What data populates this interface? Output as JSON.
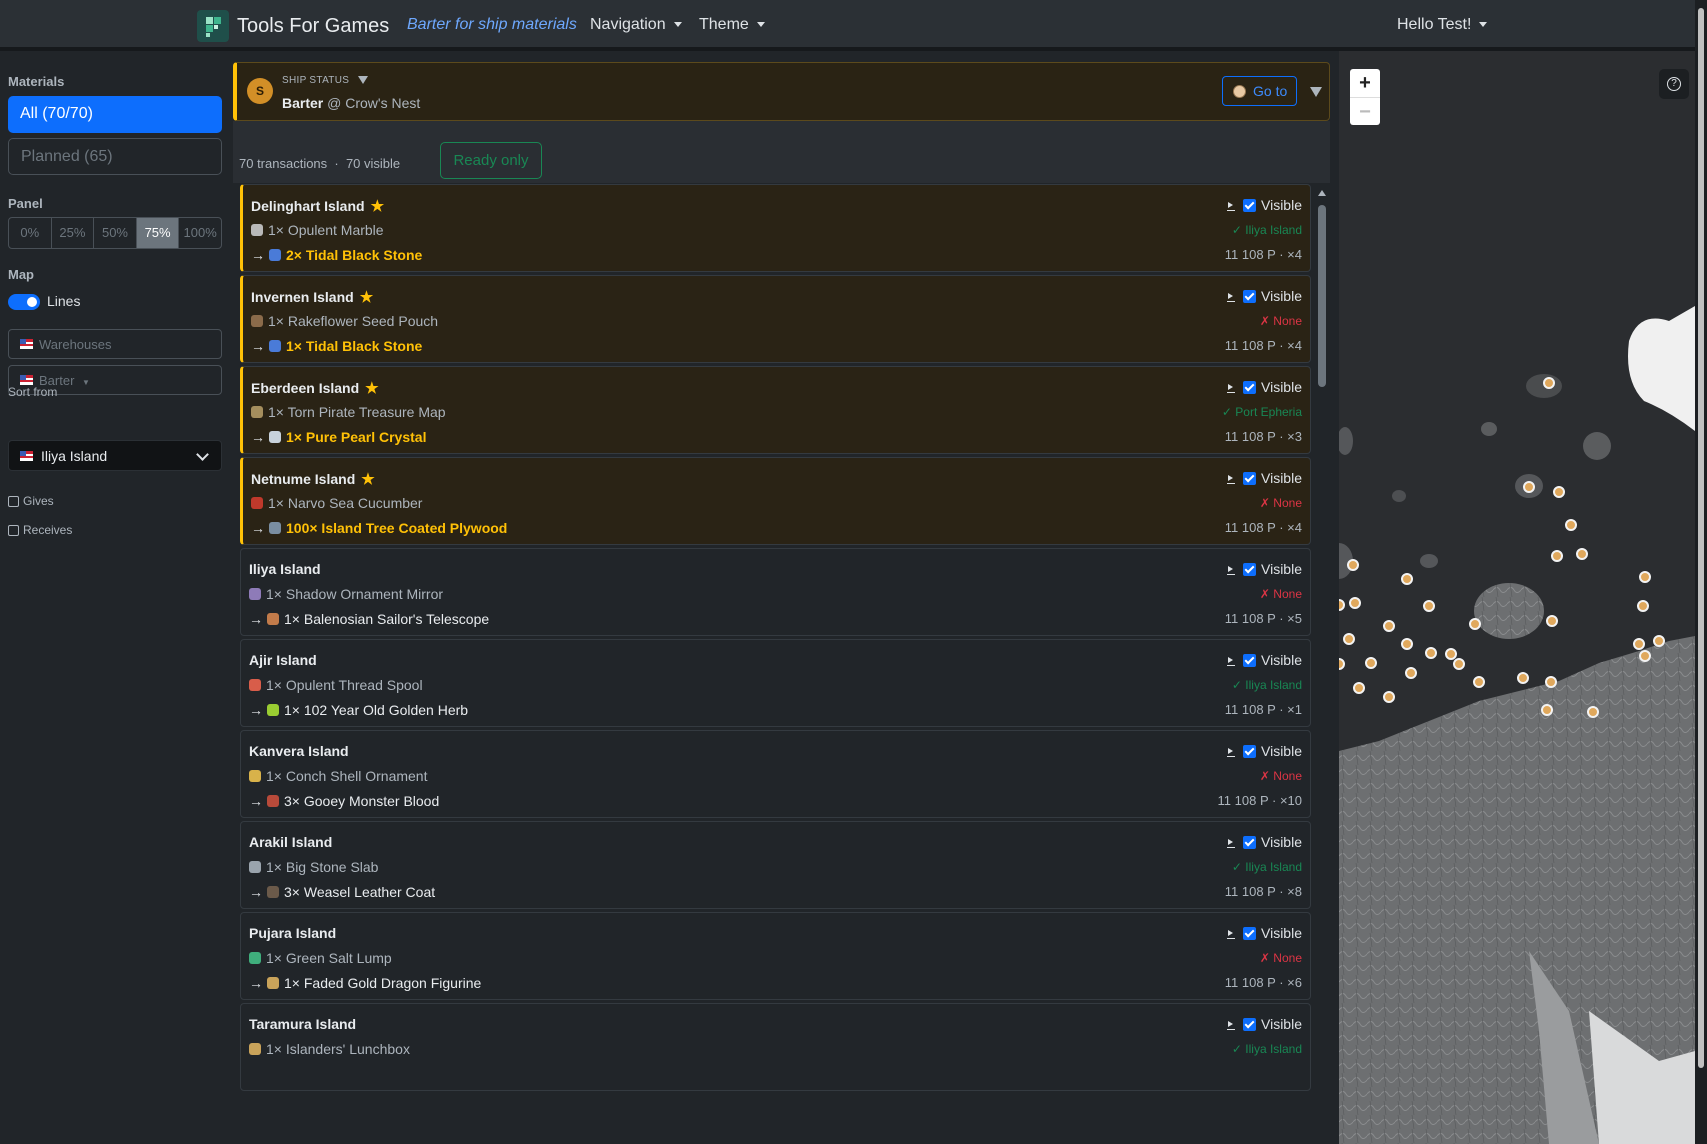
{
  "navbar": {
    "brand": "Tools For Games",
    "active_page": "Barter for ship materials",
    "navigation": "Navigation",
    "theme": "Theme",
    "user": "Hello Test!"
  },
  "sidebar": {
    "materials_label": "Materials",
    "all_button": "All (70/70)",
    "planned_button": "Planned (65)",
    "panel_label": "Panel",
    "panel_options": [
      "0%",
      "25%",
      "50%",
      "75%",
      "100%"
    ],
    "panel_selected": "75%",
    "map_label": "Map",
    "lines_label": "Lines",
    "lines_enabled": true,
    "warehouses_placeholder": "Warehouses",
    "barter_placeholder": "Barter",
    "sort_label": "Sort from",
    "sort_value": "Iliya Island",
    "gives_label": "Gives",
    "receives_label": "Receives"
  },
  "status": {
    "avatar": "S",
    "heading": "SHIP STATUS",
    "activity": "Barter",
    "location": "@ Crow's Nest",
    "goto": "Go to"
  },
  "summary": {
    "text": "70 transactions  ·  70 visible",
    "ready_only": "Ready only"
  },
  "cards": [
    {
      "island": "Delinghart Island",
      "starred": true,
      "give": "1× Opulent Marble",
      "receive": "2× Tidal Black Stone",
      "status": "✓ Iliya Island",
      "status_kind": "ok",
      "price": "11 108 P · ×4",
      "visible": "Visible"
    },
    {
      "island": "Invernen Island",
      "starred": true,
      "give": "1× Rakeflower Seed Pouch",
      "receive": "1× Tidal Black Stone",
      "status": "✗ None",
      "status_kind": "none",
      "price": "11 108 P · ×4",
      "visible": "Visible"
    },
    {
      "island": "Eberdeen Island",
      "starred": true,
      "give": "1× Torn Pirate Treasure Map",
      "receive": "1× Pure Pearl Crystal",
      "status": "✓ Port Epheria",
      "status_kind": "ok",
      "price": "11 108 P · ×3",
      "visible": "Visible"
    },
    {
      "island": "Netnume Island",
      "starred": true,
      "give": "1× Narvo Sea Cucumber",
      "receive": "100× Island Tree Coated Plywood",
      "status": "✗ None",
      "status_kind": "none",
      "price": "11 108 P · ×4",
      "visible": "Visible"
    },
    {
      "island": "Iliya Island",
      "starred": false,
      "give": "1× Shadow Ornament Mirror",
      "receive": "1× Balenosian Sailor's Telescope",
      "status": "✗ None",
      "status_kind": "none",
      "price": "11 108 P · ×5",
      "visible": "Visible"
    },
    {
      "island": "Ajir Island",
      "starred": false,
      "give": "1× Opulent Thread Spool",
      "receive": "1× 102 Year Old Golden Herb",
      "status": "✓ Iliya Island",
      "status_kind": "ok",
      "price": "11 108 P · ×1",
      "visible": "Visible"
    },
    {
      "island": "Kanvera Island",
      "starred": false,
      "give": "1× Conch Shell Ornament",
      "receive": "3× Gooey Monster Blood",
      "status": "✗ None",
      "status_kind": "none",
      "price": "11 108 P · ×10",
      "visible": "Visible"
    },
    {
      "island": "Arakil Island",
      "starred": false,
      "give": "1× Big Stone Slab",
      "receive": "3× Weasel Leather Coat",
      "status": "✓ Iliya Island",
      "status_kind": "ok",
      "price": "11 108 P · ×8",
      "visible": "Visible"
    },
    {
      "island": "Pujara Island",
      "starred": false,
      "give": "1× Green Salt Lump",
      "receive": "1× Faded Gold Dragon Figurine",
      "status": "✗ None",
      "status_kind": "none",
      "price": "11 108 P · ×6",
      "visible": "Visible"
    },
    {
      "island": "Taramura Island",
      "starred": false,
      "give": "1× Islanders' Lunchbox",
      "receive": "",
      "status": "✓ Iliya Island",
      "status_kind": "ok",
      "price": "",
      "visible": "Visible"
    }
  ],
  "colors": {
    "accent": "#0d6efd",
    "star": "#ffc107",
    "ok": "#198754",
    "none": "#dc3545",
    "marker": "#e0a85c"
  },
  "map": {
    "zoom_in": "+",
    "zoom_out": "−",
    "help": "?"
  }
}
